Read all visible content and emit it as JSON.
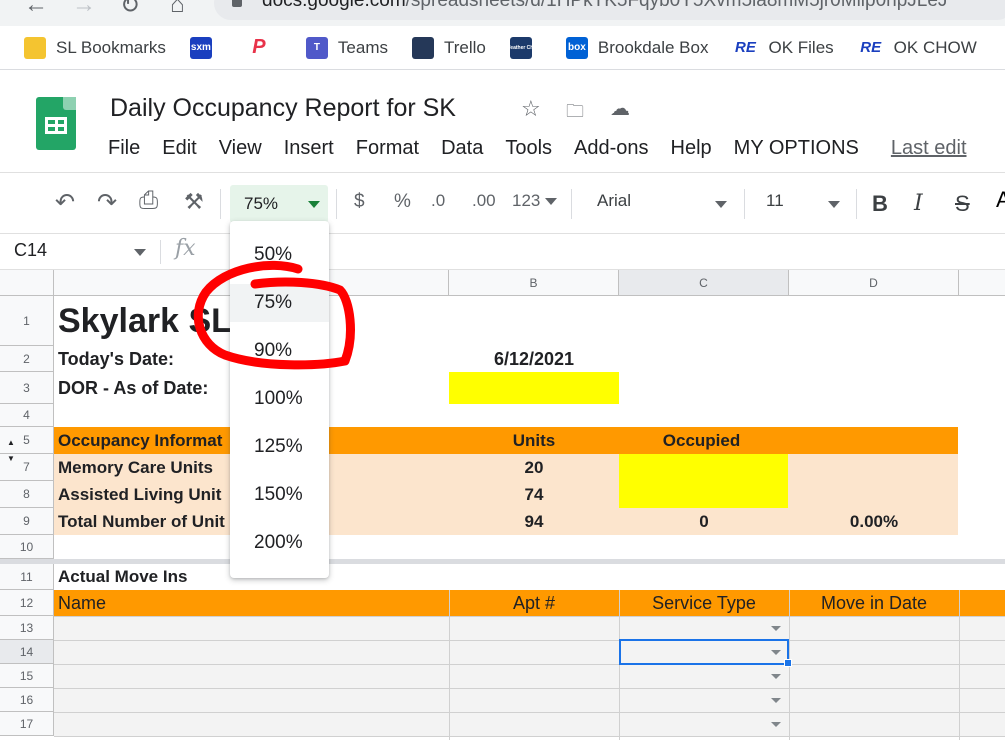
{
  "browser": {
    "url_host": "docs.google.com",
    "url_path": "/spreadsheets/d/1HPkTK5Fqyb0Y5Xvm5la8mM5jr0Mlip0npJLeJ"
  },
  "bookmarks": [
    {
      "label": "SL Bookmarks",
      "icon": "folder-icon",
      "color": "#f4c430",
      "text": ""
    },
    {
      "label": "",
      "icon": "sxm-icon",
      "color": "#1a3fbf",
      "text": "sxm"
    },
    {
      "label": "",
      "icon": "pandora-icon",
      "color": "#ffffff",
      "text": "P"
    },
    {
      "label": "Teams",
      "icon": "teams-icon",
      "color": "#5059c9",
      "text": "T"
    },
    {
      "label": "Trello",
      "icon": "trello-icon",
      "color": "#253858",
      "text": ""
    },
    {
      "label": "",
      "icon": "weather-channel-icon",
      "color": "#1c3a6b",
      "text": "The Weather Channel"
    },
    {
      "label": "Brookdale Box",
      "icon": "box-icon",
      "color": "#0061d5",
      "text": "box"
    },
    {
      "label": "OK Files",
      "icon": "re-icon",
      "color": "#ffffff",
      "text": "RE"
    },
    {
      "label": "OK CHOW",
      "icon": "re-icon",
      "color": "#ffffff",
      "text": "RE"
    }
  ],
  "doc": {
    "title": "Daily Occupancy Report for SK"
  },
  "menu": [
    "File",
    "Edit",
    "View",
    "Insert",
    "Format",
    "Data",
    "Tools",
    "Add-ons",
    "Help",
    "MY OPTIONS"
  ],
  "last_edit": "Last edit",
  "toolbar": {
    "zoom": "75%",
    "currency": "$",
    "percent": "%",
    "dec_less": ".0",
    "dec_more": ".00",
    "more_formats": "123",
    "font": "Arial",
    "font_size": "11",
    "bold": "B",
    "italic": "I",
    "strike": "S"
  },
  "formula": {
    "cell_ref": "C14",
    "fx": "fx"
  },
  "columns": [
    "B",
    "C",
    "D"
  ],
  "rows": [
    "1",
    "2",
    "3",
    "4",
    "5",
    "7",
    "8",
    "9",
    "10",
    "11",
    "12",
    "13",
    "14",
    "15",
    "16",
    "17"
  ],
  "sheet": {
    "a1": "Skylark SL",
    "a2": "Today's Date:",
    "b2": "6/12/2021",
    "a3": "DOR - As of Date:",
    "a5": "Occupancy Informat",
    "b5": "Units",
    "c5": "Occupied",
    "a7": "Memory Care Units",
    "b7": "20",
    "a8": "Assisted Living Unit",
    "b8": "74",
    "a9": "Total Number of Unit",
    "b9": "94",
    "c9": "0",
    "d9": "0.00%",
    "a11": "Actual Move Ins",
    "a12": "Name",
    "b12": "Apt #",
    "c12": "Service Type",
    "d12": "Move in Date"
  },
  "zoom_options": [
    "50%",
    "75%",
    "90%",
    "100%",
    "125%",
    "150%",
    "200%"
  ],
  "colors": {
    "orange_header": "#ff9900",
    "peach_fill": "#fce5cd",
    "yellow_fill": "#ffff00",
    "selection_blue": "#1a73e8",
    "annotation_red": "#ff0000",
    "sheets_green": "#23a566"
  }
}
